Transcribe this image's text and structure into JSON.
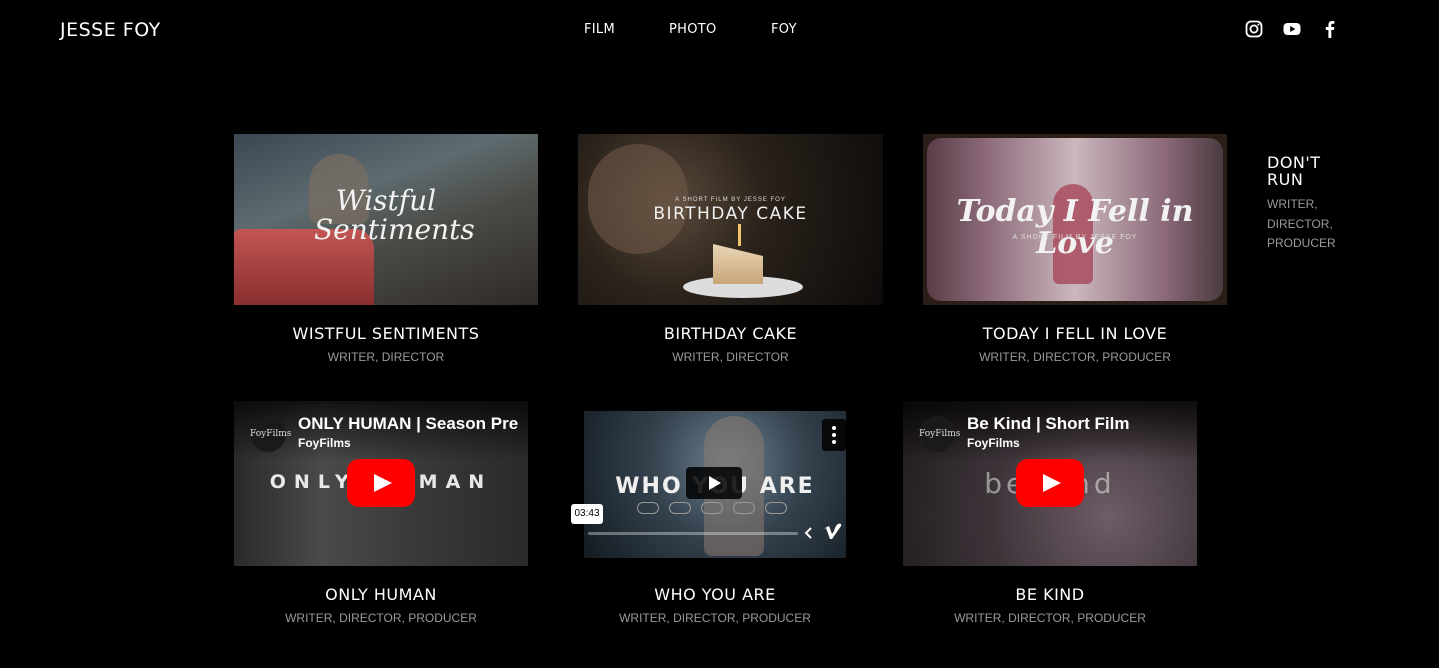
{
  "site": {
    "name": "JESSE FOY"
  },
  "nav": {
    "items": [
      "FILM",
      "PHOTO",
      "FOY"
    ]
  },
  "social": [
    "instagram-icon",
    "youtube-icon",
    "facebook-icon"
  ],
  "films": [
    {
      "title": "WISTFUL SENTIMENTS",
      "roles": "WRITER, DIRECTOR",
      "thumb_text": "Wistful Sentiments"
    },
    {
      "title": "BIRTHDAY CAKE",
      "roles": "WRITER, DIRECTOR",
      "thumb_text": "BIRTHDAY CAKE",
      "thumb_tag": "A SHORT FILM BY JESSE FOY"
    },
    {
      "title": "TODAY I FELL IN LOVE",
      "roles": "WRITER, DIRECTOR, PRODUCER",
      "thumb_text": "Today I Fell in Love",
      "thumb_tag": "A SHORT FILM BY JESSE FOY"
    },
    {
      "title": "ONLY HUMAN",
      "roles": "WRITER, DIRECTOR, PRODUCER",
      "video_title": "ONLY HUMAN | Season Pre",
      "channel": "FoyFilms",
      "thumb_text": "ONLY HUMAN"
    },
    {
      "title": "WHO YOU ARE",
      "roles": "WRITER, DIRECTOR, PRODUCER",
      "thumb_text": "WHO YOU ARE",
      "duration": "03:43"
    },
    {
      "title": "BE KIND",
      "roles": "WRITER, DIRECTOR, PRODUCER",
      "video_title": "Be Kind | Short Film",
      "channel": "FoyFilms",
      "thumb_text": "be kind"
    }
  ],
  "avatar_text": "FoyFilms",
  "side": {
    "title": "DON'T RUN",
    "roles": "WRITER, DIRECTOR, PRODUCER"
  }
}
